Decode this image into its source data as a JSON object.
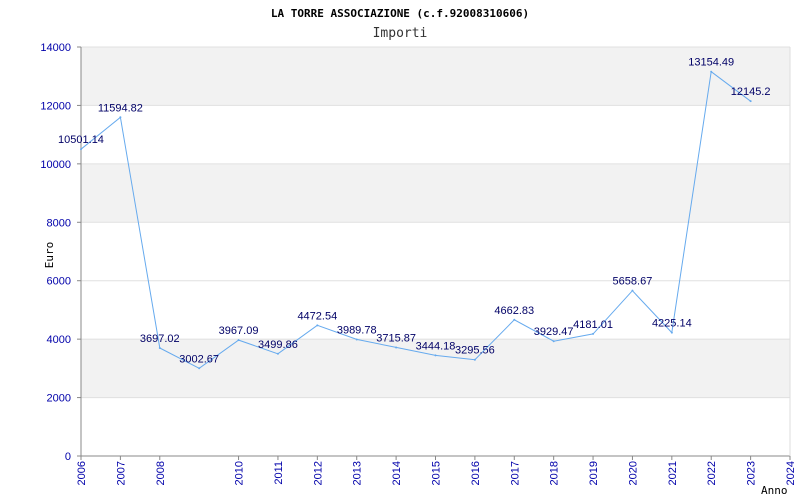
{
  "chart_data": {
    "type": "line",
    "title": "LA TORRE ASSOCIAZIONE (c.f.92008310606)",
    "subtitle": "Importi",
    "xlabel": "Anno",
    "ylabel": "Euro",
    "categories": [
      "2006",
      "2007",
      "2008",
      "2010",
      "2011",
      "2012",
      "2013",
      "2014",
      "2015",
      "2016",
      "2017",
      "2018",
      "2019",
      "2020",
      "2021",
      "2022",
      "2023",
      "2024"
    ],
    "x": [
      2006,
      2007,
      2008,
      2009,
      2010,
      2011,
      2012,
      2013,
      2014,
      2015,
      2016,
      2017,
      2018,
      2019,
      2020,
      2021,
      2022,
      2023,
      2024
    ],
    "series": [
      {
        "values": [
          10501.14,
          11594.82,
          3697.02,
          3002.67,
          3967.09,
          3499.86,
          4472.54,
          3989.78,
          3715.87,
          3444.18,
          3295.56,
          4662.83,
          3929.47,
          4181.01,
          5658.67,
          4225.14,
          13154.49,
          12145.2
        ],
        "labels": [
          "10501.14",
          "11594.82",
          "3697.02",
          "3002.67",
          "3967.09",
          "3499.86",
          "4472.54",
          "3989.78",
          "3715.87",
          "3444.18",
          "3295.56",
          "4662.83",
          "3929.47",
          "4181.01",
          "5658.67",
          "4225.14",
          "13154.49",
          "12145.2"
        ]
      }
    ],
    "yticks": [
      "0",
      "2000",
      "4000",
      "6000",
      "8000",
      "10000",
      "12000",
      "14000"
    ],
    "ylim": [
      0,
      14000
    ],
    "grid": "horizontal bands",
    "line_color": "#66aaee",
    "tick_color": "#0000aa",
    "label_color": "#000066",
    "band_color": "#f2f2f2"
  }
}
